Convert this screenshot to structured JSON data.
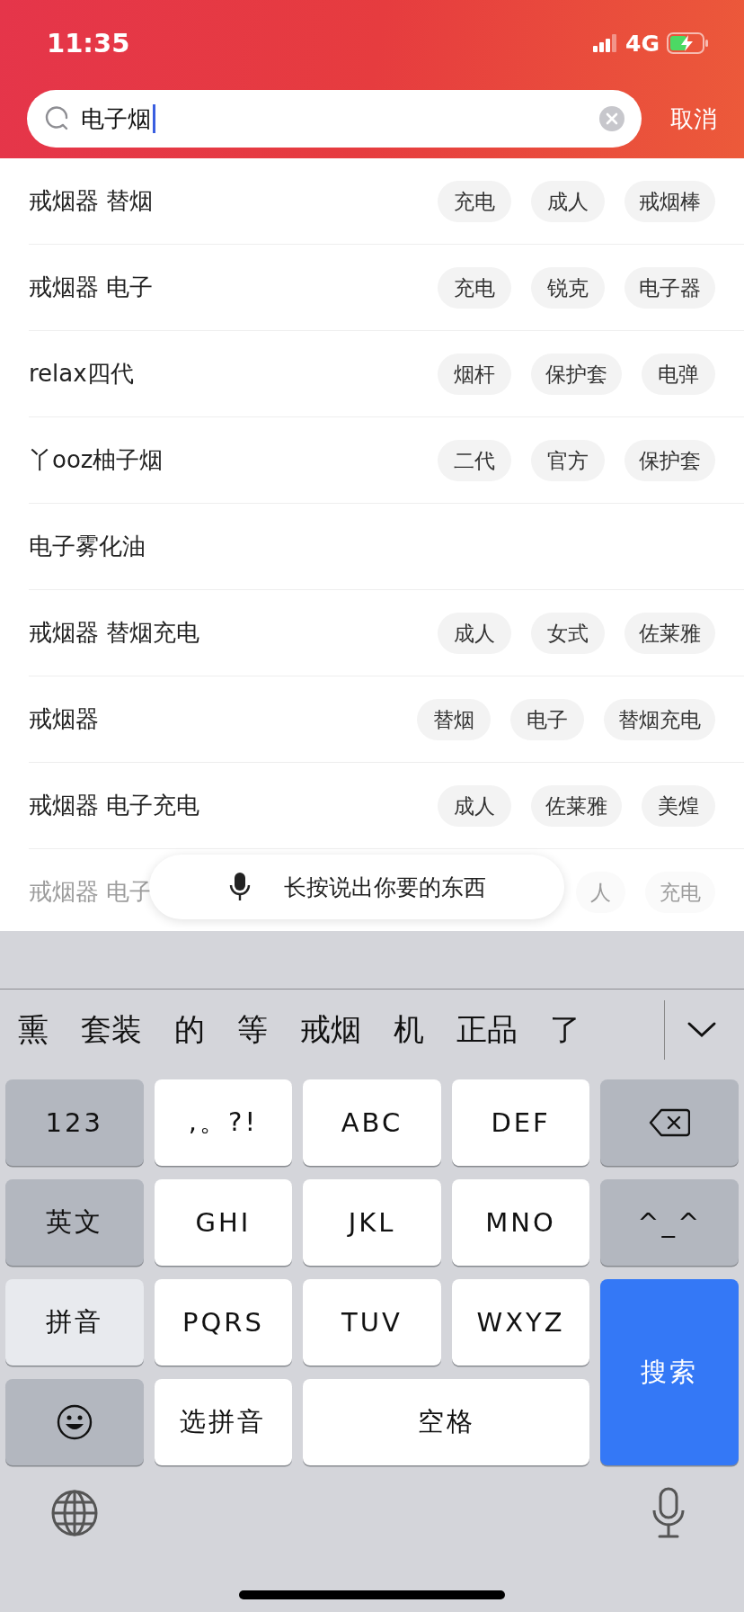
{
  "status_bar": {
    "time": "11:35",
    "network": "4G"
  },
  "search": {
    "value": "电子烟",
    "cancel": "取消"
  },
  "suggestions": [
    {
      "text": "戒烟器 替烟",
      "faded": false,
      "tags": [
        "充电",
        "成人",
        "戒烟棒"
      ]
    },
    {
      "text": "戒烟器 电子",
      "faded": false,
      "tags": [
        "充电",
        "锐克",
        "电子器"
      ]
    },
    {
      "text": "relax四代",
      "faded": false,
      "tags": [
        "烟杆",
        "保护套",
        "电弹"
      ]
    },
    {
      "text": "丫ooz柚子烟",
      "faded": false,
      "tags": [
        "二代",
        "官方",
        "保护套"
      ]
    },
    {
      "text": "电子雾化油",
      "faded": false
    },
    {
      "text": "戒烟器 替烟充电",
      "faded": false,
      "tags": [
        "成人",
        "女式",
        "佐莱雅"
      ]
    },
    {
      "text": "戒烟器",
      "faded": false,
      "tags": [
        "替烟",
        "电子",
        "替烟充电"
      ]
    },
    {
      "text": "戒烟器 电子充电",
      "faded": false,
      "tags": [
        "成人",
        "佐莱雅",
        "美煌"
      ]
    },
    {
      "text": "戒烟器 电子",
      "faded": true,
      "tags": [
        "人",
        "充电"
      ]
    }
  ],
  "voice_hint": "长按说出你要的东西",
  "candidates": [
    "熏",
    "套装",
    "的",
    "等",
    "戒烟",
    "机",
    "正品",
    "了"
  ],
  "keys": [
    {
      "kind": "function",
      "label": "123"
    },
    {
      "kind": "letter",
      "label": ",。?!"
    },
    {
      "kind": "letter",
      "label": "ABC"
    },
    {
      "kind": "letter",
      "label": "DEF"
    },
    {
      "kind": "delete"
    },
    {
      "kind": "function",
      "label": "英文"
    },
    {
      "kind": "letter",
      "label": "GHI"
    },
    {
      "kind": "letter",
      "label": "JKL"
    },
    {
      "kind": "letter",
      "label": "MNO"
    },
    {
      "kind": "function",
      "label": "^_^"
    },
    {
      "kind": "mode",
      "label": "拼音"
    },
    {
      "kind": "letter",
      "label": "PQRS"
    },
    {
      "kind": "letter",
      "label": "TUV"
    },
    {
      "kind": "letter",
      "label": "WXYZ"
    },
    {
      "kind": "action",
      "label": "搜索"
    },
    {
      "kind": "emoji"
    },
    {
      "kind": "letter",
      "label": "选拼音"
    },
    {
      "kind": "space",
      "label": "空格"
    }
  ]
}
